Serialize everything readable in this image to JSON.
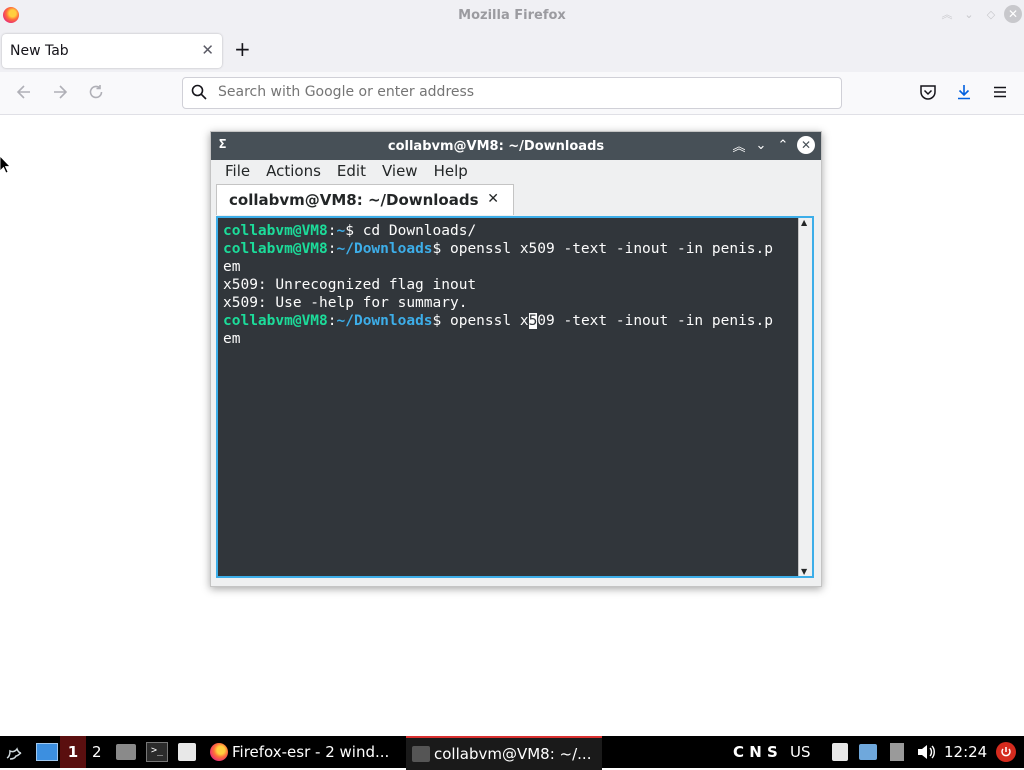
{
  "firefox": {
    "window_title": "Mozilla Firefox",
    "tab_label": "New Tab",
    "new_tab_symbol": "+",
    "url_placeholder": "Search with Google or enter address",
    "icons": [
      "back-icon",
      "forward-icon",
      "reload-icon",
      "search-icon",
      "pocket-icon",
      "downloads-icon",
      "menu-icon"
    ]
  },
  "terminal": {
    "window_title": "collabvm@VM8: ~/Downloads",
    "title_icon": "Σ",
    "menu": [
      "File",
      "Actions",
      "Edit",
      "View",
      "Help"
    ],
    "tab_label": "collabvm@VM8: ~/Downloads",
    "colors": {
      "background": "#31363b",
      "user": "#1cdc9a",
      "path": "#3daee9",
      "text": "#fcfcfc"
    },
    "lines": {
      "l1_user": "collabvm@VM8",
      "l1_colon": ":",
      "l1_path": "~",
      "l1_cmd": "$ cd Downloads/",
      "l2_user": "collabvm@VM8",
      "l2_colon": ":",
      "l2_path": "~/Downloads",
      "l2_cmd": "$ openssl x509 -text -inout -in penis.p",
      "l3": "em",
      "l4": "x509: Unrecognized flag inout",
      "l5": "x509: Use -help for summary.",
      "l6_user": "collabvm@VM8",
      "l6_colon": ":",
      "l6_path": "~/Downloads",
      "l6_cmd_a": "$ openssl x",
      "l6_cursor": "5",
      "l6_cmd_b": "09 -text -inout -in penis.p",
      "l7": "em"
    }
  },
  "taskbar": {
    "workspace_1": "1",
    "workspace_2": "2",
    "apps": [
      {
        "label": "Firefox-esr - 2 wind...",
        "icon": "firefox-icon"
      },
      {
        "label": "collabvm@VM8: ~/...",
        "icon": "terminal-icon"
      }
    ],
    "indicators": "C N S",
    "keyboard_layout": "US",
    "clock": "12:24"
  }
}
